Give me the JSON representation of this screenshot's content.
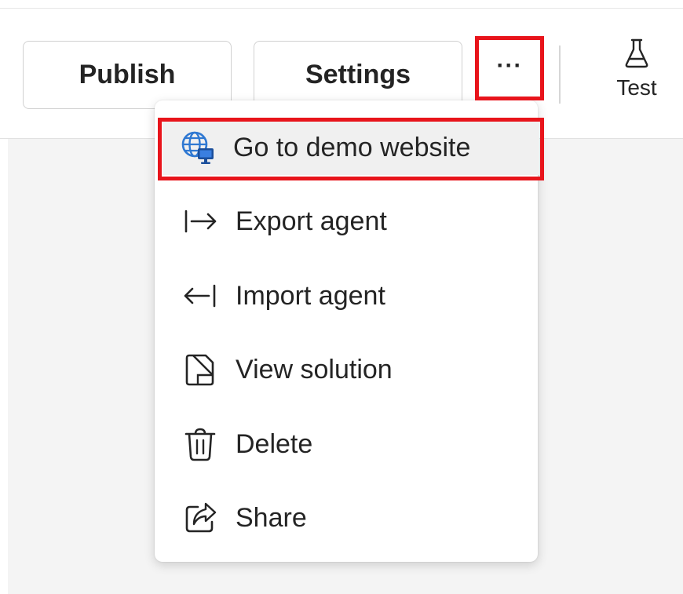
{
  "toolbar": {
    "publish_label": "Publish",
    "settings_label": "Settings",
    "more_label": "···",
    "test_label": "Test"
  },
  "menu": {
    "items": [
      {
        "label": "Go to demo website",
        "icon": "globe-monitor-icon",
        "highlighted": true
      },
      {
        "label": "Export agent",
        "icon": "arrow-export-icon"
      },
      {
        "label": "Import agent",
        "icon": "arrow-import-icon"
      },
      {
        "label": "View solution",
        "icon": "solution-icon"
      },
      {
        "label": "Delete",
        "icon": "trash-icon"
      },
      {
        "label": "Share",
        "icon": "share-icon"
      }
    ]
  },
  "colors": {
    "highlight": "#e8141b",
    "text": "#242424",
    "globe_blue": "#2f78d2"
  }
}
